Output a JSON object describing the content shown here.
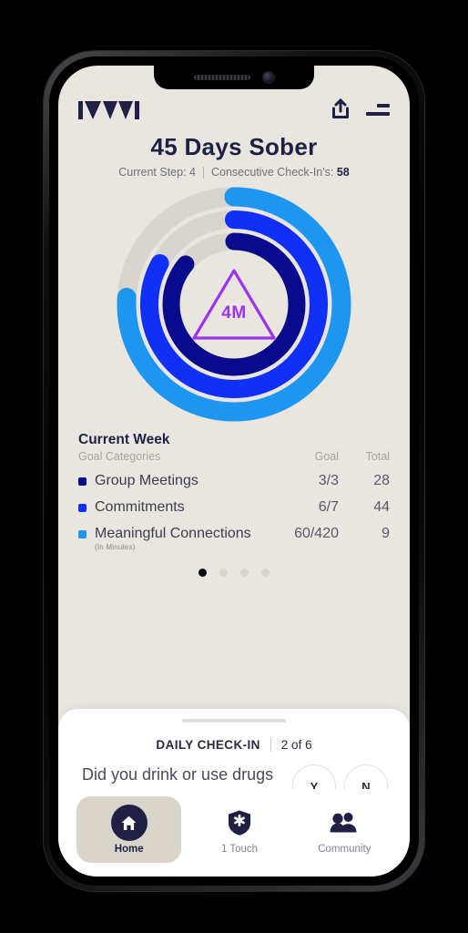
{
  "app": {
    "logo_text": "IYWI",
    "share_icon": "share-icon",
    "menu_icon": "menu-icon"
  },
  "header": {
    "title": "45 Days Sober",
    "current_step_label": "Current Step: 4",
    "consecutive_label": "Consecutive Check-In's:",
    "consecutive_value": "58"
  },
  "rings": {
    "center_badge_text": "4M",
    "center_badge_color": "#9B34EE",
    "track_color": "#D8D5CE",
    "arcs": [
      {
        "name": "meaningful-connections-ring",
        "color": "#1E95EE",
        "percent": 76
      },
      {
        "name": "commitments-ring",
        "color": "#1030F5",
        "percent": 83
      },
      {
        "name": "group-meetings-ring",
        "color": "#0A0A8C",
        "percent": 86
      }
    ]
  },
  "goals": {
    "section_title": "Current Week",
    "col_categories": "Goal Categories",
    "col_goal": "Goal",
    "col_total": "Total",
    "rows": [
      {
        "name": "Group Meetings",
        "sub": "",
        "goal": "3/3",
        "total": "28",
        "color": "#0A0A8C"
      },
      {
        "name": "Commitments",
        "sub": "",
        "goal": "6/7",
        "total": "44",
        "color": "#1030F5"
      },
      {
        "name": "Meaningful Connections",
        "sub": "(In Minutes)",
        "goal": "60/420",
        "total": "9",
        "color": "#1E95EE"
      }
    ]
  },
  "pager": {
    "total": 4,
    "active_index": 0
  },
  "checkin": {
    "label": "DAILY CHECK-IN",
    "progress": "2 of 6",
    "question": "Did you drink or use drugs today?",
    "yes_label": "Y",
    "no_label": "N"
  },
  "tabs": [
    {
      "label": "Home",
      "icon": "home-icon",
      "active": true
    },
    {
      "label": "1 Touch",
      "icon": "shield-icon",
      "active": false
    },
    {
      "label": "Community",
      "icon": "people-icon",
      "active": false
    }
  ]
}
